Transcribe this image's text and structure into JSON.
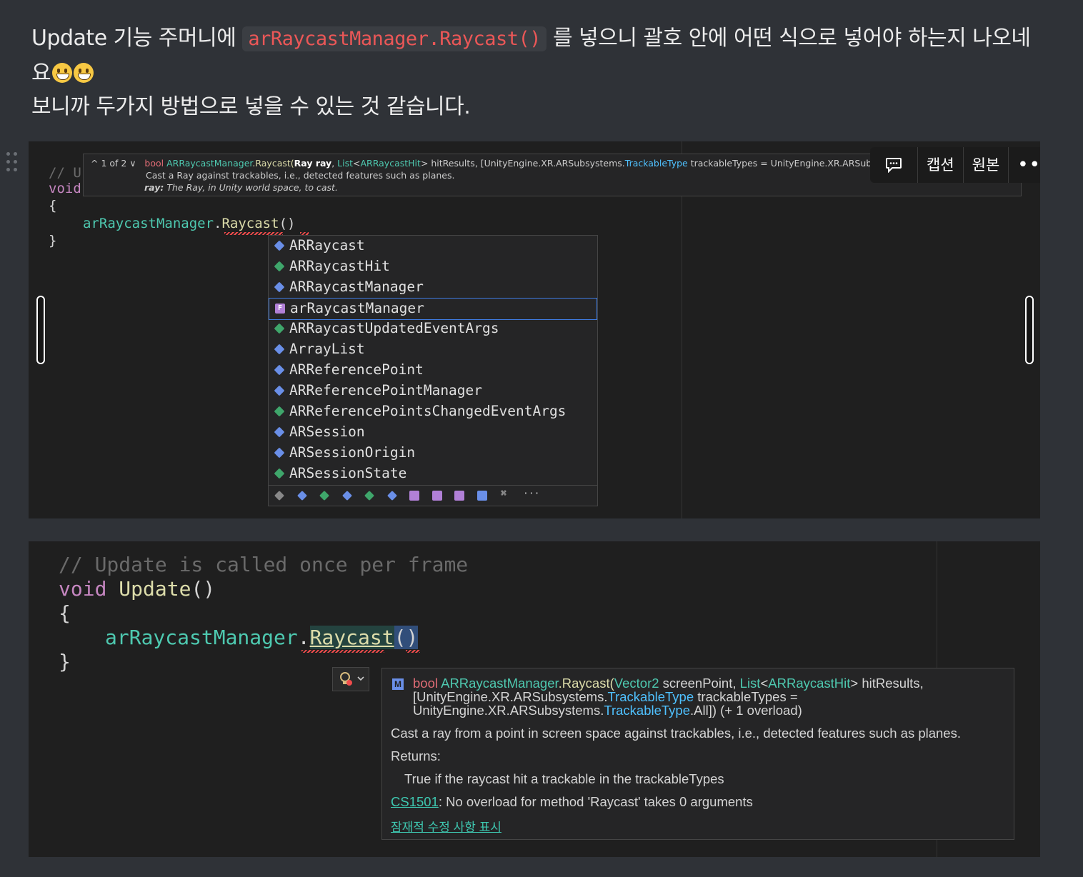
{
  "post": {
    "p1_a": "Update 기능 주머니에 ",
    "p1_code": "arRaycastManager.Raycast()",
    "p1_b": " 를 넣으니 괄호 안에 어떤 식으로 넣어야 하는지 나오네요",
    "p2": "보니까 두가지 방법으로 넣을 수 있는 것 같습니다."
  },
  "image_toolbar": {
    "caption": "캡션",
    "original": "원본"
  },
  "image1": {
    "code": {
      "comment": "// U",
      "void": "void",
      "open": "{",
      "obj": "arRaycastManager",
      "dot": ".",
      "method": "Raycast",
      "parens": "()",
      "close": "}"
    },
    "signature_tip": {
      "counter": "1 of 2",
      "ret": "bool",
      "cls": "ARRaycastManager",
      "method": ".Raycast(",
      "param_bold": "Ray ray",
      "comma": ", ",
      "list": "List",
      "lt": "<",
      "hit": "ARRaycastHit",
      "rest1": "> hitResults, [UnityEngine.XR.ARSubsystems.",
      "trk": "TrackableType",
      "rest2": " trackableTypes = UnityEngine.XR.ARSubsystems.TrackableType.All])",
      "desc": "Cast a Ray against trackables, i.e., detected features such as planes.",
      "param_name": "ray:",
      "param_desc": " The Ray, in Unity world space, to cast."
    },
    "autocomplete": [
      {
        "label": "ARRaycast",
        "kind": "class"
      },
      {
        "label": "ARRaycastHit",
        "kind": "struct"
      },
      {
        "label": "ARRaycastManager",
        "kind": "class"
      },
      {
        "label": "arRaycastManager",
        "kind": "field",
        "selected": true
      },
      {
        "label": "ARRaycastUpdatedEventArgs",
        "kind": "struct"
      },
      {
        "label": "ArrayList",
        "kind": "class"
      },
      {
        "label": "ARReferencePoint",
        "kind": "class"
      },
      {
        "label": "ARReferencePointManager",
        "kind": "class"
      },
      {
        "label": "ARReferencePointsChangedEventArgs",
        "kind": "struct"
      },
      {
        "label": "ARSession",
        "kind": "class"
      },
      {
        "label": "ARSessionOrigin",
        "kind": "class"
      },
      {
        "label": "ARSessionState",
        "kind": "struct"
      }
    ],
    "footer_more": "⌘",
    "footer_dots": "···"
  },
  "image2": {
    "code": {
      "comment": "// Update is called once per frame",
      "void": "void",
      "fn": "Update",
      "fn_parens": "()",
      "open": "{",
      "obj": "arRaycastManager",
      "dot": ".",
      "method": "Raycast",
      "parens": "()",
      "close": "}"
    },
    "hover": {
      "badge": "M",
      "ret": "bool",
      "cls": "ARRaycastManager",
      "method": ".Raycast(",
      "vec": "Vector2",
      "p1": " screenPoint, ",
      "list": "List",
      "lt": "<",
      "hit": "ARRaycastHit",
      "p2": "> hitResults,",
      "line2_a": "[UnityEngine.XR.ARSubsystems.",
      "trk": "TrackableType",
      "line2_b": " trackableTypes =",
      "line3_a": "UnityEngine.XR.ARSubsystems.",
      "trk2": "TrackableType",
      "line3_b": ".All]) (+ 1 overload)",
      "desc": "Cast a ray from a point in screen space against trackables, i.e., detected features such as planes.",
      "returns": "Returns:",
      "returns_desc": "True if the raycast hit a trackable in the trackableTypes",
      "error_code": "CS1501",
      "error_msg": ": No overload for method 'Raycast' takes 0 arguments",
      "fix_link": "잠재적 수정 사항 표시"
    }
  },
  "colors": {
    "keyword": "#c586c0",
    "field": "#4ec9b0",
    "function": "#dcdcaa",
    "comment": "#6a9955"
  }
}
